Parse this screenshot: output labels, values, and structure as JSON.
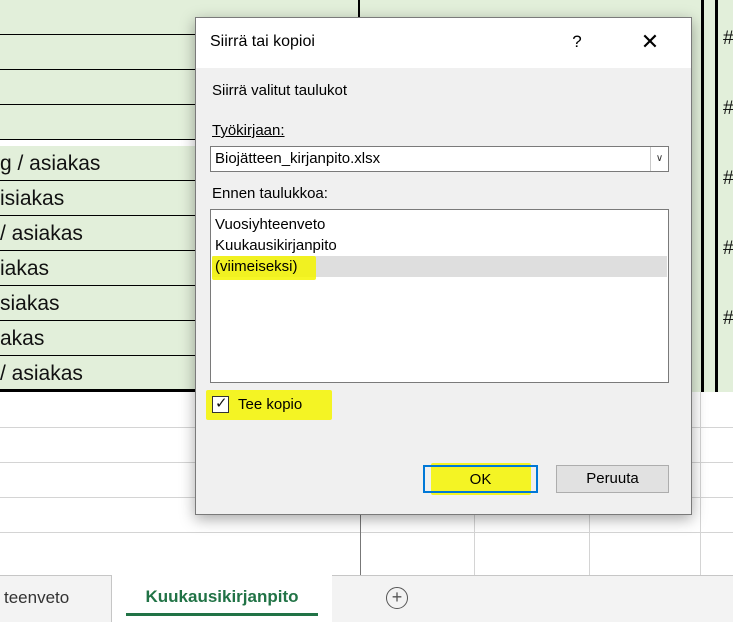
{
  "sheet": {
    "rows": [
      "",
      "",
      "",
      "",
      "g / asiakas",
      "isiakas",
      "/ asiakas",
      "iakas",
      "siakas",
      "akas",
      "/ asiakas"
    ],
    "hash_text": "##",
    "partial_hash": "#"
  },
  "tabs": {
    "inactive_label": "teenveto",
    "active_label": "Kuukausikirjanpito",
    "add_symbol": "+"
  },
  "dialog": {
    "title": "Siirrä tai kopioi",
    "help_symbol": "?",
    "close_symbol": "✕",
    "heading": "Siirrä valitut taulukot",
    "workbook_label": "Työkirjaan:",
    "workbook_value": "Biojätteen_kirjanpito.xlsx",
    "before_label": "Ennen taulukkoa:",
    "sheet_list": [
      "Vuosiyhteenveto",
      "Kuukausikirjanpito",
      "(viimeiseksi)"
    ],
    "selected_index": 2,
    "copy_label": "Tee kopio",
    "copy_checked": true,
    "ok_label": "OK",
    "cancel_label": "Peruuta"
  },
  "colors": {
    "sheet_fill": "#e2efda",
    "excel_green": "#217346",
    "highlight": "#f5f500",
    "default_button_border": "#0078d7"
  }
}
